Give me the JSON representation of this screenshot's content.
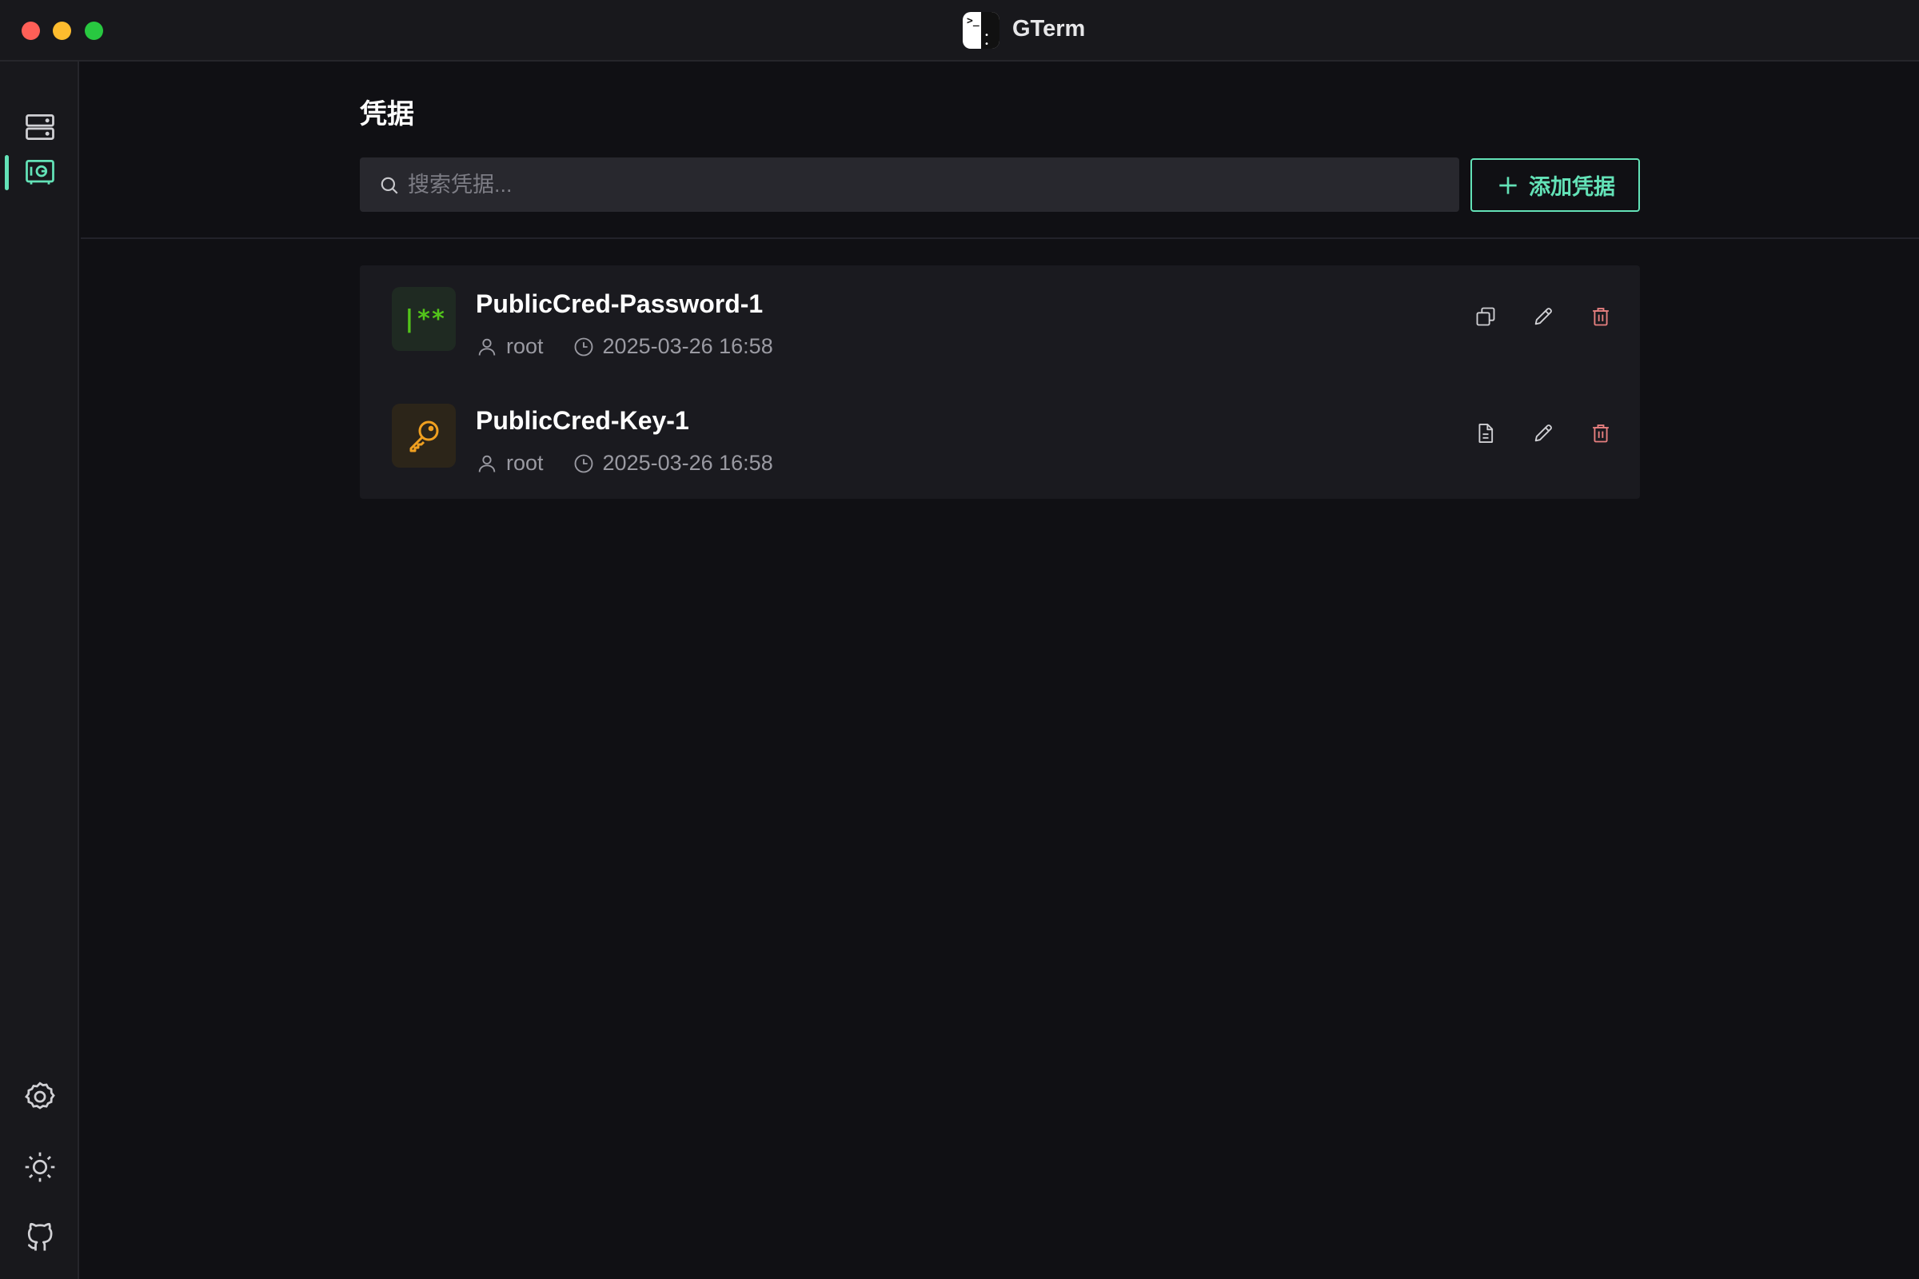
{
  "window": {
    "title": "GTerm",
    "traffic_lights": [
      "close",
      "minimize",
      "maximize"
    ],
    "logo_icon": "gterm-logo-icon"
  },
  "sidebar": {
    "top_items": [
      {
        "name": "servers",
        "icon": "server-stack-icon",
        "active": false
      },
      {
        "name": "credentials",
        "icon": "vault-icon",
        "active": true
      }
    ],
    "bottom_items": [
      {
        "name": "settings",
        "icon": "gear-icon"
      },
      {
        "name": "theme",
        "icon": "sun-icon"
      },
      {
        "name": "github",
        "icon": "github-icon"
      }
    ],
    "active_color": "#63e2b7"
  },
  "main": {
    "title": "凭据",
    "search": {
      "placeholder": "搜索凭据...",
      "value": "",
      "icon": "search-icon"
    },
    "add_button": {
      "label": "添加凭据",
      "icon": "plus-icon",
      "color": "#63e2b7"
    },
    "credentials": [
      {
        "name": "PublicCred-Password-1",
        "type": "password",
        "type_icon_text": "|**",
        "user": "root",
        "time": "2025-03-26 16:58",
        "actions": [
          "copy-icon",
          "edit-icon",
          "delete-icon"
        ]
      },
      {
        "name": "PublicCred-Key-1",
        "type": "key",
        "type_icon": "key-icon",
        "user": "root",
        "time": "2025-03-26 16:58",
        "actions": [
          "file-icon",
          "edit-icon",
          "delete-icon"
        ]
      }
    ]
  },
  "colors": {
    "background": "#101014",
    "panel": "#18181c",
    "accent": "#63e2b7",
    "danger": "#e88080",
    "password_icon": "#52c41a",
    "key_icon": "#f0a020"
  }
}
